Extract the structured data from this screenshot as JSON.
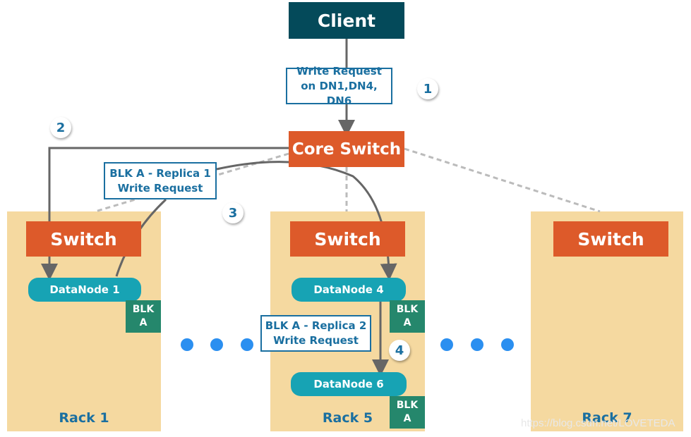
{
  "client": "Client",
  "core_switch": "Core Switch",
  "write_request": {
    "line1": "Write Request",
    "line2": "on DN1,DN4, DN6"
  },
  "replica1": {
    "line1": "BLK A - Replica 1",
    "line2": "Write Request"
  },
  "replica2": {
    "line1": "BLK A - Replica 2",
    "line2": "Write Request"
  },
  "steps": [
    "1",
    "2",
    "3",
    "4"
  ],
  "racks": [
    {
      "label": "Rack 1",
      "switch": "Switch"
    },
    {
      "label": "Rack 5",
      "switch": "Switch"
    },
    {
      "label": "Rack 7",
      "switch": "Switch"
    }
  ],
  "datanodes": [
    "DataNode 1",
    "DataNode 4",
    "DataNode 6"
  ],
  "block": {
    "line1": "BLK",
    "line2": "A"
  },
  "watermark": "https://blog.csdn.net/LOVETEDA",
  "colors": {
    "client": "#044a5a",
    "switch": "#dd5a2a",
    "datanode": "#17a3b4",
    "block": "#25876c",
    "rack": "#f5d9a0",
    "text": "#1a6fa0",
    "dots": "#2b8ff0"
  }
}
